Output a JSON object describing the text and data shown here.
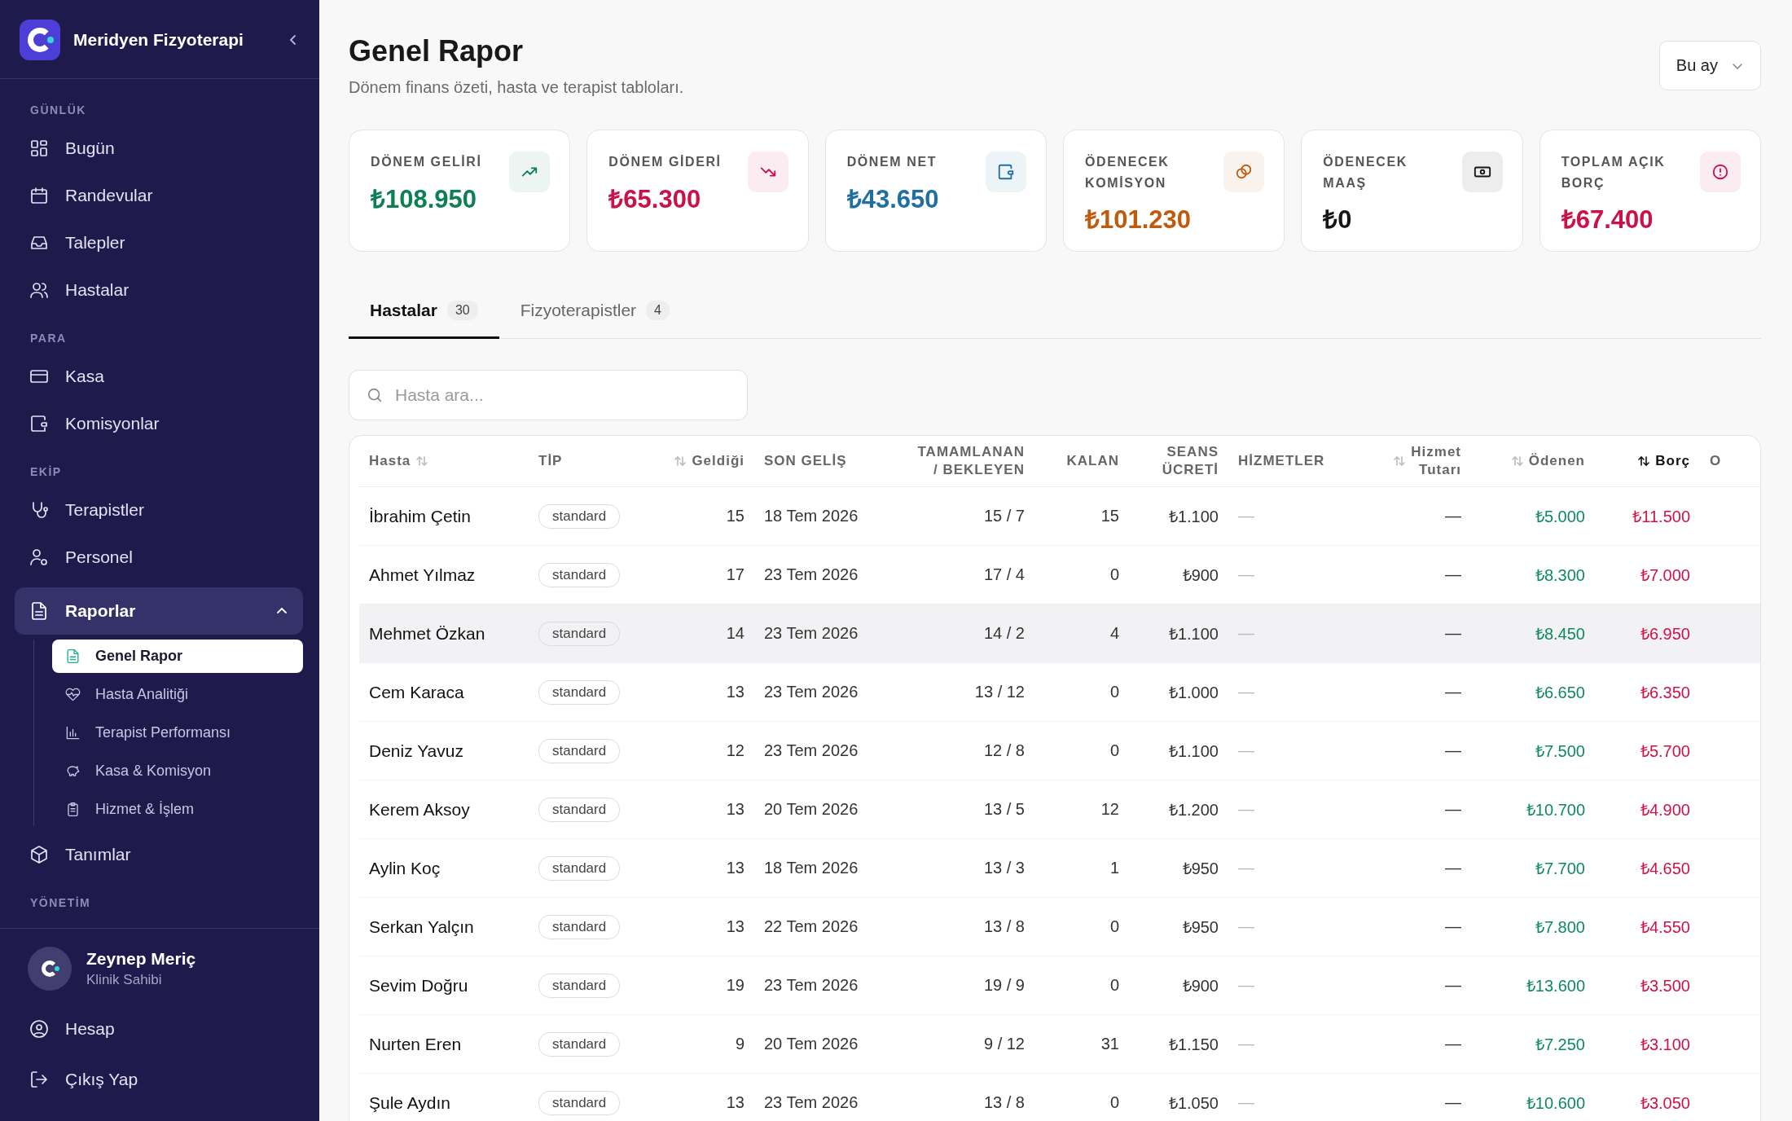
{
  "sidebar": {
    "brand": "Meridyen Fizyoterapi",
    "sections": [
      {
        "title": "GÜNLÜK",
        "items": [
          {
            "label": "Bugün"
          },
          {
            "label": "Randevular"
          },
          {
            "label": "Talepler"
          },
          {
            "label": "Hastalar"
          }
        ]
      },
      {
        "title": "PARA",
        "items": [
          {
            "label": "Kasa"
          },
          {
            "label": "Komisyonlar"
          }
        ]
      },
      {
        "title": "EKİP",
        "items": [
          {
            "label": "Terapistler"
          },
          {
            "label": "Personel"
          },
          {
            "label": "Raporlar",
            "expanded": true,
            "children": [
              {
                "label": "Genel Rapor",
                "selected": true
              },
              {
                "label": "Hasta Analitiği",
                "selected": false
              },
              {
                "label": "Terapist Performansı",
                "selected": false
              },
              {
                "label": "Kasa & Komisyon",
                "selected": false
              },
              {
                "label": "Hizmet & İşlem",
                "selected": false
              }
            ]
          },
          {
            "label": "Tanımlar"
          }
        ]
      },
      {
        "title": "YÖNETİM"
      }
    ],
    "user": {
      "name": "Zeynep Meriç",
      "role": "Klinik Sahibi"
    },
    "footer_items": [
      {
        "label": "Hesap"
      },
      {
        "label": "Çıkış Yap"
      }
    ]
  },
  "header": {
    "title": "Genel Rapor",
    "subtitle": "Dönem finans özeti, hasta ve terapist tabloları.",
    "period": "Bu ay"
  },
  "cards": [
    {
      "label": "DÖNEM GELİRİ",
      "value": "₺108.950",
      "color": "#0d7f55"
    },
    {
      "label": "DÖNEM GİDERİ",
      "value": "₺65.300",
      "color": "#c9114a"
    },
    {
      "label": "DÖNEM NET",
      "value": "₺43.650",
      "color": "#1f6fa3"
    },
    {
      "label": "ÖDENECEK KOMİSYON",
      "value": "₺101.230",
      "color": "#c05a0c"
    },
    {
      "label": "ÖDENECEK MAAŞ",
      "value": "₺0",
      "color": "#161616"
    },
    {
      "label": "TOPLAM AÇIK BORÇ",
      "value": "₺67.400",
      "color": "#c9114a"
    }
  ],
  "tabs": [
    {
      "label": "Hastalar",
      "count": "30",
      "selected": true
    },
    {
      "label": "Fizyoterapistler",
      "count": "4",
      "selected": false
    }
  ],
  "search": {
    "placeholder": "Hasta ara..."
  },
  "table": {
    "columns": [
      {
        "lines": [
          "Hasta"
        ],
        "kind": "name",
        "sortable": true,
        "sorted": false
      },
      {
        "lines": [
          "TİP"
        ],
        "kind": "badge"
      },
      {
        "lines": [
          "Geldiği"
        ],
        "kind": "num",
        "sortable": true,
        "sorted": false
      },
      {
        "lines": [
          "SON GELİŞ"
        ],
        "kind": "text"
      },
      {
        "lines": [
          "TAMAMLANAN",
          "/ BEKLEYEN"
        ],
        "kind": "num"
      },
      {
        "lines": [
          "KALAN"
        ],
        "kind": "num"
      },
      {
        "lines": [
          "SEANS",
          "ÜCRETİ"
        ],
        "kind": "num"
      },
      {
        "lines": [
          "HİZMETLER"
        ],
        "kind": "muted"
      },
      {
        "lines": [
          "Hizmet",
          "Tutarı"
        ],
        "kind": "num",
        "sortable": true,
        "sorted": false
      },
      {
        "lines": [
          "Ödenen"
        ],
        "kind": "paid",
        "sortable": true,
        "sorted": false
      },
      {
        "lines": [
          "Borç"
        ],
        "kind": "debt",
        "sortable": true,
        "sorted": true
      },
      {
        "lines": [
          "O"
        ],
        "kind": "text"
      }
    ],
    "rows": [
      {
        "hovered": false,
        "cells": [
          "İbrahim Çetin",
          "standard",
          "15",
          "18 Tem 2026",
          "15 / 7",
          "15",
          "₺1.100",
          "—",
          "—",
          "₺5.000",
          "₺11.500"
        ]
      },
      {
        "hovered": false,
        "cells": [
          "Ahmet Yılmaz",
          "standard",
          "17",
          "23 Tem 2026",
          "17 / 4",
          "0",
          "₺900",
          "—",
          "—",
          "₺8.300",
          "₺7.000"
        ]
      },
      {
        "hovered": true,
        "cells": [
          "Mehmet Özkan",
          "standard",
          "14",
          "23 Tem 2026",
          "14 / 2",
          "4",
          "₺1.100",
          "—",
          "—",
          "₺8.450",
          "₺6.950"
        ]
      },
      {
        "hovered": false,
        "cells": [
          "Cem Karaca",
          "standard",
          "13",
          "23 Tem 2026",
          "13 / 12",
          "0",
          "₺1.000",
          "—",
          "—",
          "₺6.650",
          "₺6.350"
        ]
      },
      {
        "hovered": false,
        "cells": [
          "Deniz Yavuz",
          "standard",
          "12",
          "23 Tem 2026",
          "12 / 8",
          "0",
          "₺1.100",
          "—",
          "—",
          "₺7.500",
          "₺5.700"
        ]
      },
      {
        "hovered": false,
        "cells": [
          "Kerem Aksoy",
          "standard",
          "13",
          "20 Tem 2026",
          "13 / 5",
          "12",
          "₺1.200",
          "—",
          "—",
          "₺10.700",
          "₺4.900"
        ]
      },
      {
        "hovered": false,
        "cells": [
          "Aylin Koç",
          "standard",
          "13",
          "18 Tem 2026",
          "13 / 3",
          "1",
          "₺950",
          "—",
          "—",
          "₺7.700",
          "₺4.650"
        ]
      },
      {
        "hovered": false,
        "cells": [
          "Serkan Yalçın",
          "standard",
          "13",
          "22 Tem 2026",
          "13 / 8",
          "0",
          "₺950",
          "—",
          "—",
          "₺7.800",
          "₺4.550"
        ]
      },
      {
        "hovered": false,
        "cells": [
          "Sevim Doğru",
          "standard",
          "19",
          "23 Tem 2026",
          "19 / 9",
          "0",
          "₺900",
          "—",
          "—",
          "₺13.600",
          "₺3.500"
        ]
      },
      {
        "hovered": false,
        "cells": [
          "Nurten Eren",
          "standard",
          "9",
          "20 Tem 2026",
          "9 / 12",
          "31",
          "₺1.150",
          "—",
          "—",
          "₺7.250",
          "₺3.100"
        ]
      },
      {
        "hovered": false,
        "cells": [
          "Şule Aydın",
          "standard",
          "13",
          "23 Tem 2026",
          "13 / 8",
          "0",
          "₺1.050",
          "—",
          "—",
          "₺10.600",
          "₺3.050"
        ]
      }
    ]
  }
}
